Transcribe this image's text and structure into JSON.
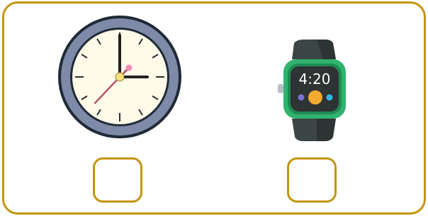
{
  "options": [
    {
      "name": "analog-clock",
      "icon": "analog-clock-icon",
      "checked": false
    },
    {
      "name": "smart-watch",
      "icon": "smart-watch-icon",
      "display_time": "4:20",
      "checked": false
    }
  ],
  "colors": {
    "border": "#c2950f",
    "clock_rim": "#7f8aa8",
    "clock_face": "#fffbe9",
    "watch_band": "#3d4646",
    "watch_case": "#2fb36f",
    "watch_screen": "#2e3333"
  }
}
